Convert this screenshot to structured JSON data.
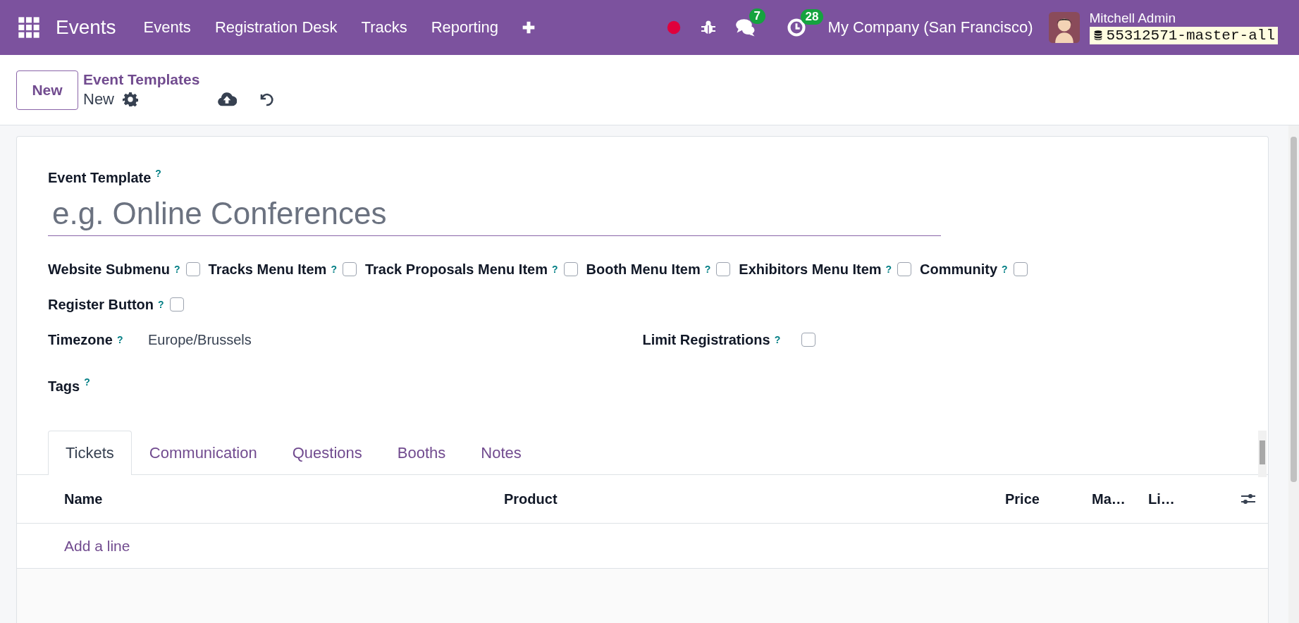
{
  "navbar": {
    "app_name": "Events",
    "menu": [
      "Events",
      "Registration Desk",
      "Tracks",
      "Reporting"
    ],
    "chat_count": "7",
    "activity_count": "28",
    "company": "My Company (San Francisco)",
    "user": "Mitchell Admin",
    "database": "55312571-master-all"
  },
  "control_panel": {
    "new_button": "New",
    "breadcrumb": "Event Templates",
    "record": "New"
  },
  "form": {
    "title_label": "Event Template",
    "title_help": "?",
    "title_placeholder": "e.g. Online Conferences",
    "settings_rows": [
      [
        {
          "label": "Website Submenu",
          "help": "?",
          "checked": false
        },
        {
          "label": "Tracks Menu Item",
          "help": "?",
          "checked": false
        },
        {
          "label": "Track Proposals Menu Item",
          "help": "?",
          "checked": false
        },
        {
          "label": "Booth Menu Item",
          "help": "?",
          "checked": false
        },
        {
          "label": "Exhibitors Menu Item",
          "help": "?",
          "checked": false
        },
        {
          "label": "Community",
          "help": "?",
          "checked": false
        }
      ],
      [
        {
          "label": "Register Button",
          "help": "?",
          "checked": false
        }
      ]
    ],
    "timezone": {
      "label": "Timezone",
      "help": "?",
      "value": "Europe/Brussels"
    },
    "limit_registrations": {
      "label": "Limit Registrations",
      "help": "?",
      "checked": false
    },
    "tags": {
      "label": "Tags",
      "help": "?"
    },
    "tabs": [
      {
        "label": "Tickets",
        "selected": true
      },
      {
        "label": "Communication",
        "selected": false
      },
      {
        "label": "Questions",
        "selected": false
      },
      {
        "label": "Booths",
        "selected": false
      },
      {
        "label": "Notes",
        "selected": false
      }
    ],
    "table": {
      "columns": [
        "Name",
        "Product",
        "Price",
        "Ma…",
        "Li…"
      ],
      "add_line": "Add a line"
    }
  }
}
